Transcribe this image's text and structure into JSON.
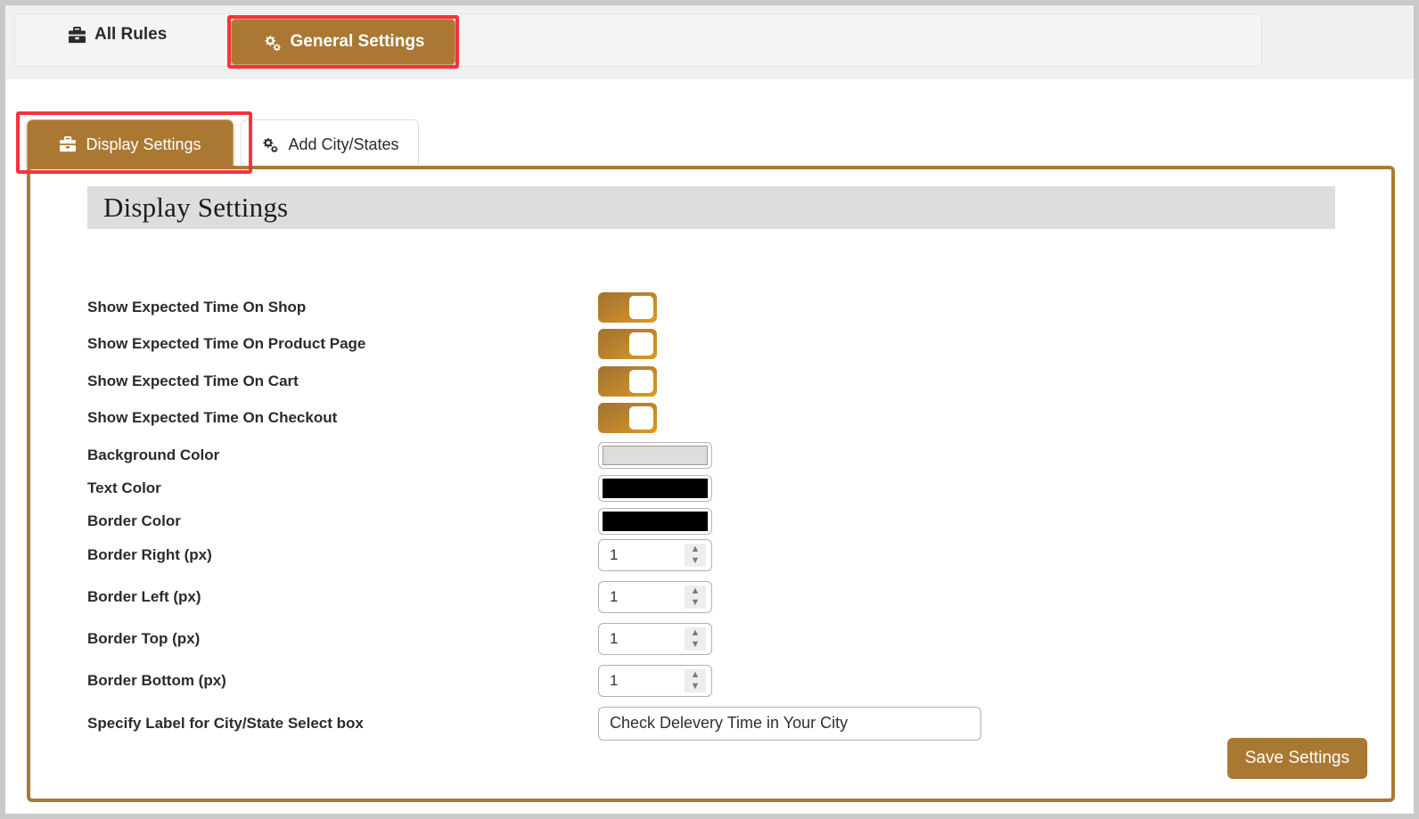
{
  "theme": {
    "accent": "#ab7833",
    "highlight": "#f8333c",
    "header_band": "#f0f0f0",
    "title_bar": "#dddddd",
    "toggle_gradient_from": "#a07330",
    "toggle_gradient_to": "#dd9a1e"
  },
  "top_tabs": [
    {
      "label": "All Rules",
      "icon": "briefcase-icon",
      "active": false
    },
    {
      "label": "General Settings",
      "icon": "cogs-icon",
      "active": true
    }
  ],
  "sub_tabs": [
    {
      "label": "Display Settings",
      "icon": "briefcase-icon",
      "active": true
    },
    {
      "label": "Add City/States",
      "icon": "cogs-icon",
      "active": false
    }
  ],
  "panel": {
    "title": "Display Settings",
    "save_label": "Save Settings"
  },
  "fields": [
    {
      "label": "Show Expected Time On Shop",
      "type": "toggle",
      "value": "on"
    },
    {
      "label": "Show Expected Time On Product Page",
      "type": "toggle",
      "value": "on"
    },
    {
      "label": "Show Expected Time On Cart",
      "type": "toggle",
      "value": "on"
    },
    {
      "label": "Show Expected Time On Checkout",
      "type": "toggle",
      "value": "on"
    },
    {
      "label": "Background Color",
      "type": "color",
      "value": "#dddddd"
    },
    {
      "label": "Text Color",
      "type": "color",
      "value": "#000000"
    },
    {
      "label": "Border Color",
      "type": "color",
      "value": "#000000"
    },
    {
      "label": "Border Right (px)",
      "type": "number",
      "value": "1"
    },
    {
      "label": "Border Left (px)",
      "type": "number",
      "value": "1"
    },
    {
      "label": "Border Top (px)",
      "type": "number",
      "value": "1"
    },
    {
      "label": "Border Bottom (px)",
      "type": "number",
      "value": "1"
    },
    {
      "label": "Specify Label for City/State Select box",
      "type": "text",
      "value": "Check Delevery Time in Your City",
      "placeholder": ""
    }
  ],
  "spinner": {
    "up": "▲",
    "down": "▼"
  }
}
